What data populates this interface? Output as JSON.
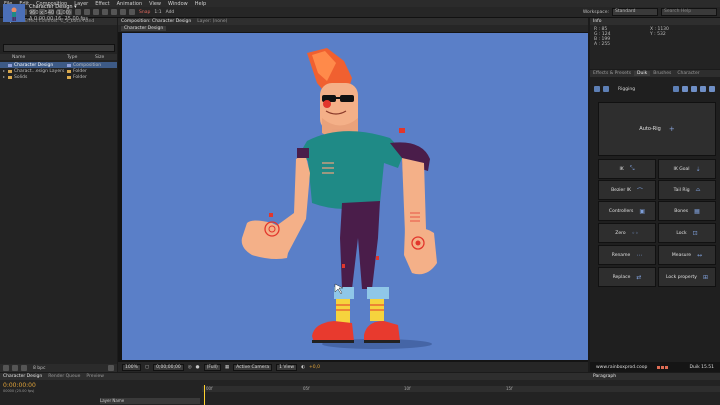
{
  "menu": [
    "File",
    "Edit",
    "Composition",
    "Layer",
    "Effect",
    "Animation",
    "View",
    "Window",
    "Help"
  ],
  "toolbar": {
    "snapping": "Snap",
    "mode": "1:1",
    "other": "Add",
    "workspace_label": "Workspace:",
    "workspace_value": "Standard",
    "search_placeholder": "Search Help"
  },
  "project": {
    "tabs": [
      "Project",
      "Effect Controls: C_3_back hand"
    ],
    "item_name": "Character Design ▾",
    "item_size": "960 x 540 (1,00)",
    "item_duration": "Δ 0:00:00:16, 25,00 fps",
    "columns": {
      "name": "Name",
      "type": "Type",
      "size": "Size"
    },
    "rows": [
      {
        "name": "Character Design",
        "type": "Composition"
      },
      {
        "name": "Charact...esign Layers",
        "type": "Folder"
      },
      {
        "name": "Solids",
        "type": "Folder"
      }
    ],
    "footer": "8 bpc"
  },
  "comp": {
    "tabs": [
      "Composition: Character Design",
      "Layer: (none)"
    ],
    "subtab": "Character Design",
    "viewer_bar": {
      "zoom": "100%",
      "timecode": "0;00;00;00",
      "quality": "(Full)",
      "camera": "Active Camera",
      "views": "1 View",
      "offset": "+0,0"
    }
  },
  "info": {
    "tab": "Info",
    "rgb": [
      "R : 85",
      "G : 124",
      "B : 199",
      "A : 255"
    ],
    "xy": [
      "X : 1130",
      "Y : 532"
    ]
  },
  "duik": {
    "tabs": [
      "Effects & Presets",
      "Duik",
      "Brushes",
      "Character"
    ],
    "section": "Rigging",
    "autorig": "Auto-Rig",
    "buttons": [
      {
        "label": "IK",
        "glyph": "⤡"
      },
      {
        "label": "IK Goal",
        "glyph": "⇣"
      },
      {
        "label": "Bezier IK",
        "glyph": "⌒"
      },
      {
        "label": "Tail Rig",
        "glyph": "⌓"
      },
      {
        "label": "Controllers",
        "glyph": "▣"
      },
      {
        "label": "Bones",
        "glyph": "▦"
      },
      {
        "label": "Zero",
        "glyph": "◦◦"
      },
      {
        "label": "Lock",
        "glyph": "⊡"
      },
      {
        "label": "Rename",
        "glyph": "⋯"
      },
      {
        "label": "Measure",
        "glyph": "↔"
      },
      {
        "label": "Replace",
        "glyph": "⇄"
      },
      {
        "label": "Lock property",
        "glyph": "⊞"
      }
    ],
    "website": "www.rainboxprod.coop",
    "version": "Duik 15.51"
  },
  "timeline": {
    "tabs": [
      "Character Design",
      "Render Queue",
      "Preview"
    ],
    "timecode": "0:00:00:00",
    "fps": "00000 (25.00 fps)",
    "ticks": [
      "00f",
      "05f",
      "10f",
      "15f"
    ],
    "layer": "Layer Name",
    "para_tab": "Paragraph"
  },
  "colors": {
    "stage": "#5a7fc8",
    "accent": "#e0a33a",
    "duik_icon": "#5d7fb5"
  }
}
